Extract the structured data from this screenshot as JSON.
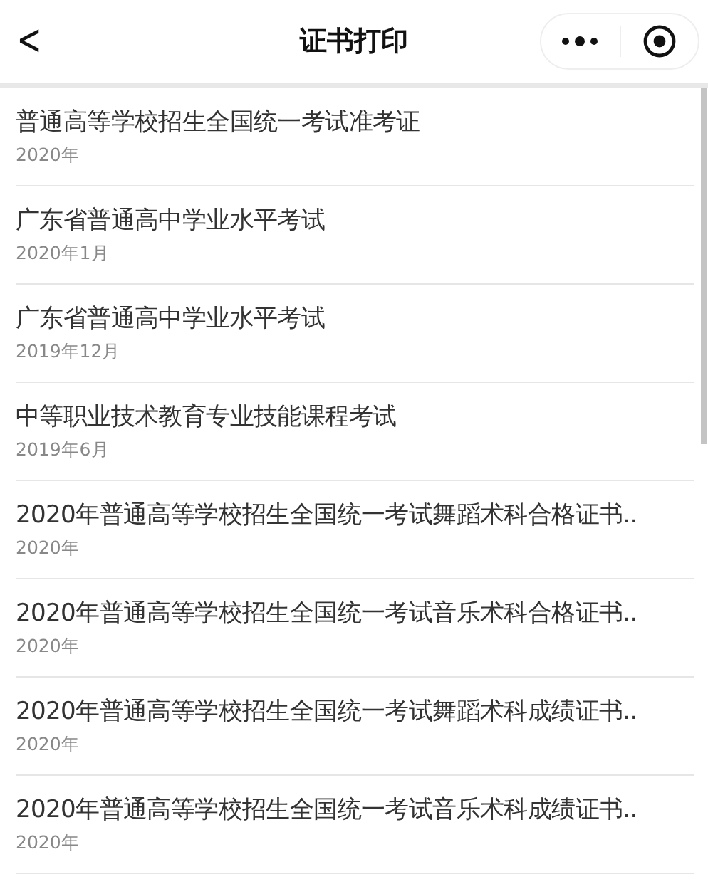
{
  "header": {
    "title": "证书打印",
    "back": "<"
  },
  "items": [
    {
      "title": "普通高等学校招生全国统一考试准考证",
      "date": "2020年"
    },
    {
      "title": "广东省普通高中学业水平考试",
      "date": "2020年1月"
    },
    {
      "title": "广东省普通高中学业水平考试",
      "date": "2019年12月"
    },
    {
      "title": "中等职业技术教育专业技能课程考试",
      "date": "2019年6月"
    },
    {
      "title": "2020年普通高等学校招生全国统一考试舞蹈术科合格证书..",
      "date": "2020年"
    },
    {
      "title": "2020年普通高等学校招生全国统一考试音乐术科合格证书..",
      "date": "2020年"
    },
    {
      "title": "2020年普通高等学校招生全国统一考试舞蹈术科成绩证书..",
      "date": "2020年"
    },
    {
      "title": "2020年普通高等学校招生全国统一考试音乐术科成绩证书..",
      "date": "2020年"
    }
  ]
}
